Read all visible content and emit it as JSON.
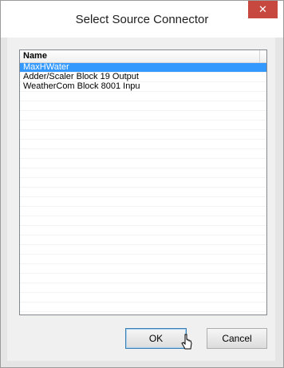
{
  "window": {
    "title": "Select Source Connector",
    "close_label": "✕"
  },
  "list": {
    "column_header": "Name",
    "rows": [
      {
        "label": "MaxHWater",
        "selected": true
      },
      {
        "label": "Adder/Scaler Block 19 Output",
        "selected": false
      },
      {
        "label": "WeatherCom Block 8001 Inpu",
        "selected": false
      }
    ]
  },
  "buttons": {
    "ok": "OK",
    "cancel": "Cancel"
  },
  "colors": {
    "selection": "#3399ff",
    "close": "#c7483f"
  }
}
